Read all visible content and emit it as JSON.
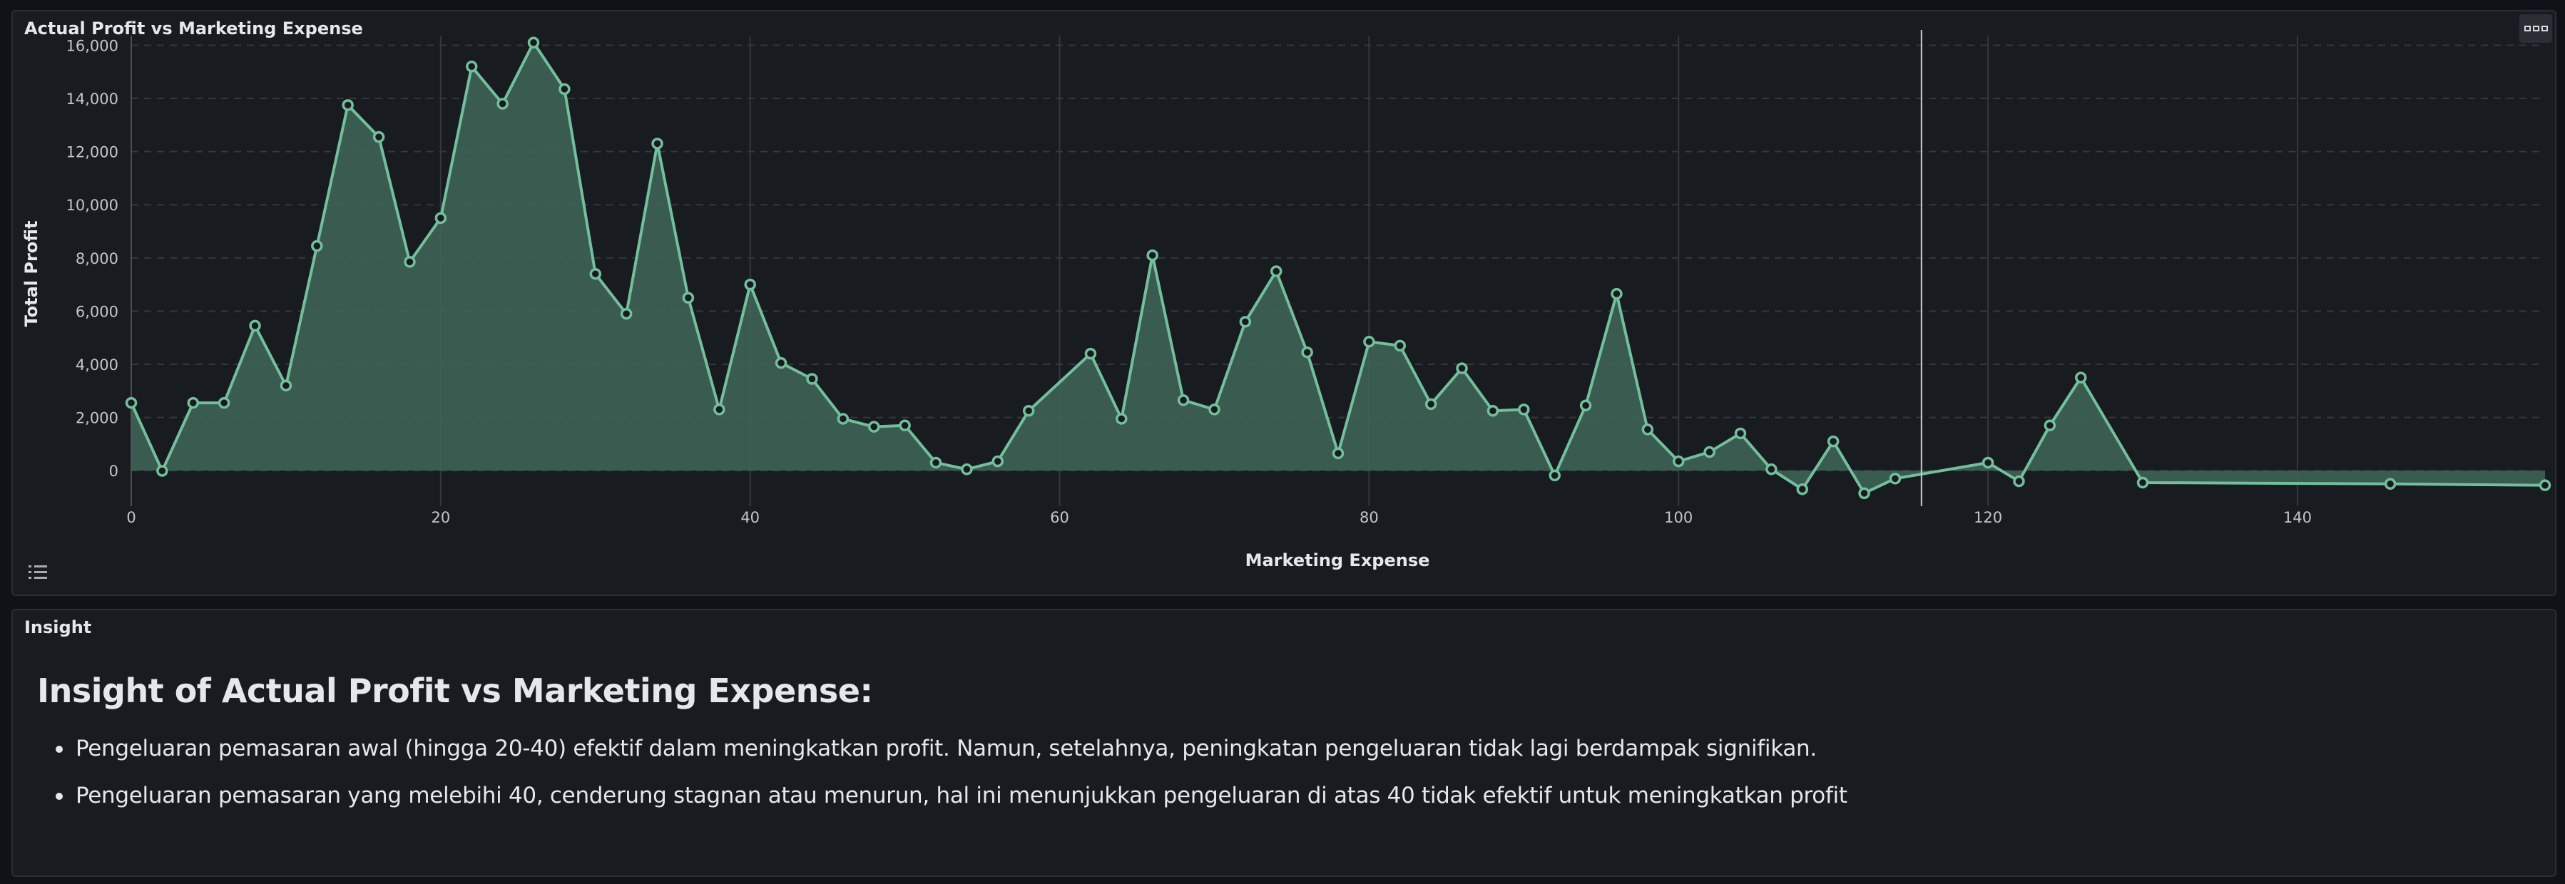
{
  "chart_panel": {
    "title": "Actual Profit vs Marketing Expense"
  },
  "insight_panel": {
    "title": "Insight",
    "heading": "Insight of Actual Profit vs Marketing Expense:",
    "points": [
      "Pengeluaran pemasaran awal (hingga 20-40) efektif dalam meningkatkan profit. Namun, setelahnya, peningkatan pengeluaran tidak lagi berdampak signifikan.",
      "Pengeluaran pemasaran yang melebihi 40, cenderung stagnan atau menurun, hal ini menunjukkan pengeluaran di atas 40 tidak efektif untuk meningkatkan profit"
    ]
  },
  "colors": {
    "line": "#73bf9c",
    "fill": "#3f6659",
    "grid": "#34373d",
    "cursor": "#c9cbd0"
  },
  "chart_data": {
    "type": "area",
    "title": "Actual Profit vs Marketing Expense",
    "xlabel": "Marketing Expense",
    "ylabel": "Total Profit",
    "xlim": [
      0,
      156
    ],
    "ylim": [
      -800,
      16200
    ],
    "x_ticks": [
      0,
      20,
      40,
      60,
      80,
      100,
      120,
      140
    ],
    "y_ticks": [
      0,
      2000,
      4000,
      6000,
      8000,
      10000,
      12000,
      14000,
      16000
    ],
    "y_tick_labels": [
      "0",
      "2,000",
      "4,000",
      "6,000",
      "8,000",
      "10,000",
      "12,000",
      "14,000",
      "16,000"
    ],
    "grid": true,
    "cursor_x": 115.7,
    "x": [
      0,
      2,
      4,
      6,
      8,
      10,
      12,
      14,
      16,
      18,
      20,
      22,
      24,
      26,
      28,
      30,
      32,
      34,
      36,
      38,
      40,
      42,
      44,
      46,
      48,
      50,
      52,
      54,
      56,
      58,
      62,
      64,
      66,
      68,
      70,
      72,
      74,
      76,
      78,
      80,
      82,
      84,
      86,
      88,
      90,
      92,
      94,
      96,
      98,
      100,
      102,
      104,
      106,
      108,
      110,
      112,
      114,
      120,
      122,
      124,
      126,
      130,
      146,
      156
    ],
    "series": [
      {
        "values": [
          2550,
          -10,
          2550,
          2550,
          5450,
          3200,
          8450,
          13750,
          12550,
          7850,
          9500,
          15200,
          13800,
          16100,
          14350,
          7400,
          5900,
          12300,
          6500,
          2300,
          7000,
          4050,
          3450,
          1950,
          1650,
          1700,
          300,
          50,
          350,
          2250,
          4400,
          1950,
          8100,
          2650,
          2300,
          5600,
          7500,
          4450,
          650,
          4850,
          4700,
          2500,
          3850,
          2250,
          2300,
          -180,
          2450,
          6650,
          1550,
          350,
          700,
          1400,
          50,
          -700,
          1100,
          -850,
          -300,
          300,
          -400,
          1700,
          3500,
          -450,
          -500,
          -550
        ]
      }
    ]
  }
}
